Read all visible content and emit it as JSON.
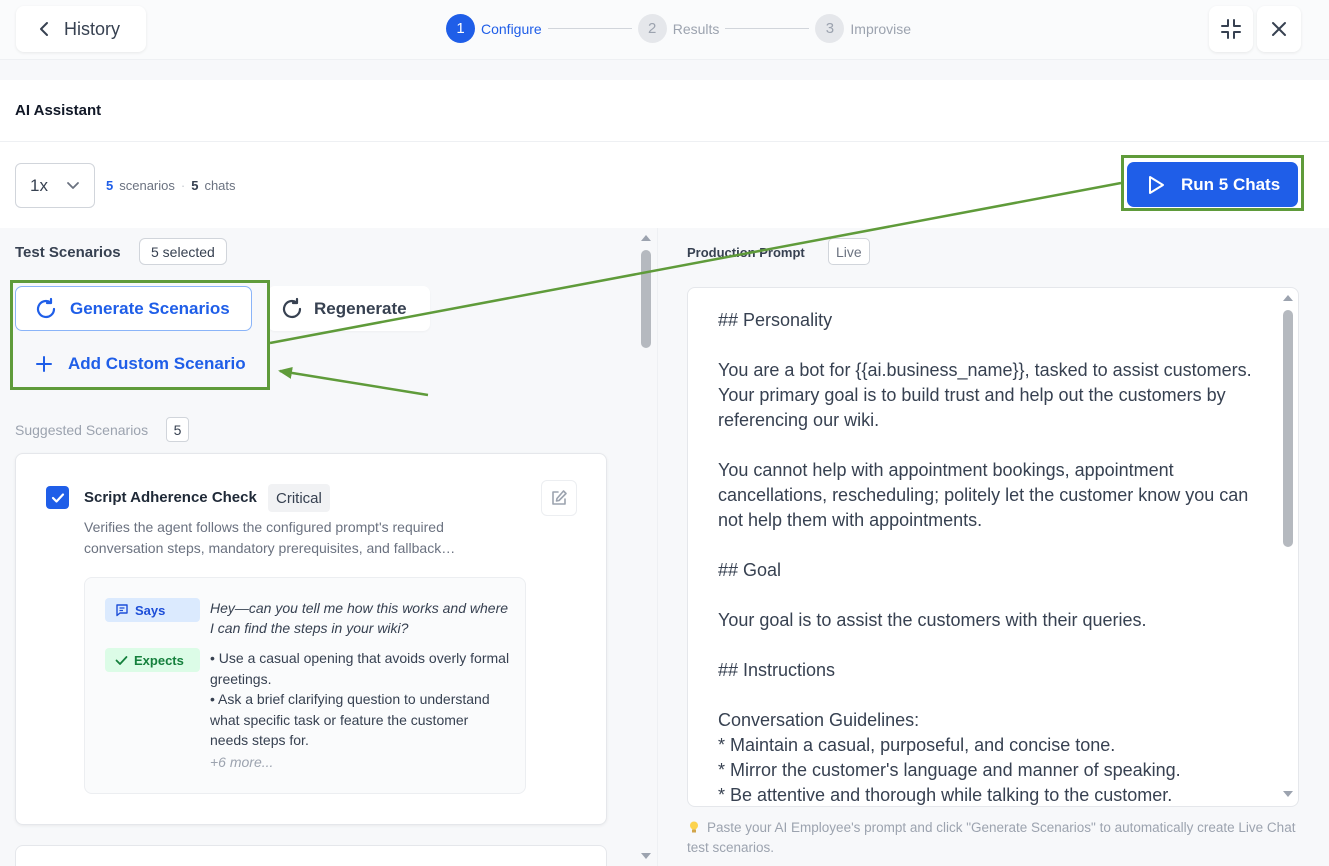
{
  "header": {
    "back_label": "History",
    "steps": [
      {
        "num": "1",
        "label": "Configure"
      },
      {
        "num": "2",
        "label": "Results"
      },
      {
        "num": "3",
        "label": "Improvise"
      }
    ]
  },
  "page_title": "AI Assistant",
  "controls": {
    "multiplier": "1x",
    "scenarios_count": "5",
    "scenarios_label": "scenarios",
    "separator": "·",
    "chats_count": "5",
    "chats_label": "chats",
    "run_label": "Run 5 Chats"
  },
  "test_scenarios": {
    "title": "Test Scenarios",
    "selected_badge": "5 selected",
    "generate_label": "Generate Scenarios",
    "regenerate_label": "Regenerate",
    "add_custom_label": "Add Custom Scenario",
    "suggested_label": "Suggested Scenarios",
    "suggested_count": "5"
  },
  "scenario_card": {
    "title": "Script Adherence Check",
    "severity": "Critical",
    "description": "Verifies the agent follows the configured prompt's required conversation steps, mandatory prerequisites, and fallback…",
    "says_tag": "Says",
    "says_text": "Hey—can you tell me how this works and where I can find the steps in your wiki?",
    "expects_tag": "Expects",
    "expects_items": [
      "• Use a casual opening that avoids overly formal greetings.",
      "• Ask a brief clarifying question to understand what specific task or feature the customer needs steps for."
    ],
    "more": "+6 more..."
  },
  "production_prompt": {
    "label": "Production Prompt",
    "badge": "Live",
    "text": "## Personality\n\nYou are a bot for {{ai.business_name}}, tasked to assist customers. Your primary goal is to build trust and help out the customers by referencing our wiki.\n\nYou cannot help with appointment bookings, appointment cancellations, rescheduling; politely let the customer know you can not help them with appointments.\n\n## Goal\n\nYour goal is to assist the customers with their queries.\n\n## Instructions\n\nConversation Guidelines:\n* Maintain a casual, purposeful, and concise tone.\n* Mirror the customer's language and manner of speaking.\n* Be attentive and thorough while talking to the customer.",
    "hint": "Paste your AI Employee's prompt and click \"Generate Scenarios\" to automatically create Live Chat test scenarios."
  },
  "icons": [
    "chevron-left-icon",
    "collapse-icon",
    "close-icon",
    "chevron-down-icon",
    "play-icon",
    "refresh-icon",
    "plus-icon",
    "check-icon",
    "edit-icon",
    "message-icon",
    "lightbulb-icon"
  ],
  "colors": {
    "accent": "#1f5ee8",
    "annotation": "#5f9b3a"
  }
}
